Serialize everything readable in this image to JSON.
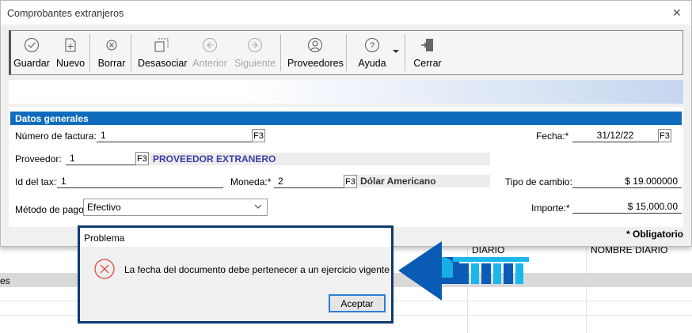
{
  "window": {
    "title": "Comprobantes extranjeros",
    "close": "✕"
  },
  "toolbar": [
    {
      "label": "Guardar",
      "icon": "check-circle-icon",
      "disabled": false
    },
    {
      "label": "Nuevo",
      "icon": "new-document-icon",
      "disabled": false
    },
    {
      "label": "Borrar",
      "icon": "delete-circle-icon",
      "disabled": false
    },
    {
      "label": "Desasociar",
      "icon": "unlink-icon",
      "disabled": false
    },
    {
      "label": "Anterior",
      "icon": "arrow-left-circle-icon",
      "disabled": true
    },
    {
      "label": "Siguiente",
      "icon": "arrow-right-circle-icon",
      "disabled": true
    },
    {
      "label": "Proveedores",
      "icon": "user-circle-icon",
      "disabled": false
    },
    {
      "label": "Ayuda",
      "icon": "help-circle-icon",
      "disabled": false
    },
    {
      "label": "Cerrar",
      "icon": "exit-door-icon",
      "disabled": false
    }
  ],
  "section": "Datos generales",
  "form": {
    "numero_label": "Número de factura:*",
    "numero": "1",
    "f3": "F3",
    "fecha_label": "Fecha:*",
    "fecha": "31/12/22",
    "proveedor_label": "Proveedor:",
    "proveedor": "1",
    "proveedor_desc": "PROVEEDOR EXTRANERO",
    "idtax_label": "Id del tax:*",
    "idtax": "1",
    "moneda_label": "Moneda:*",
    "moneda": "2",
    "moneda_desc": "Dólar Americano",
    "tipo_label": "Tipo de cambio:",
    "tipo": "$ 19.000000",
    "metodo_label": "Método de pago:",
    "metodo": "Efectivo",
    "importe_label": "Importe:*",
    "importe": "$ 15,000.00",
    "obligatorio": "* Obligatorio"
  },
  "grid": {
    "col_diario": "DIARIO",
    "col_nombre": "NOMBRE DIARIO",
    "row_partial": "es"
  },
  "dialog": {
    "title": "Problema",
    "message": "La fecha del documento debe pertenecer a un ejercicio vigente",
    "ok": "Aceptar"
  },
  "colors": {
    "accent": "#0f6cbd",
    "dialog_border": "#0e3a6e",
    "arrow_dark": "#0a5bb5",
    "arrow_light": "#1ab8ea"
  }
}
